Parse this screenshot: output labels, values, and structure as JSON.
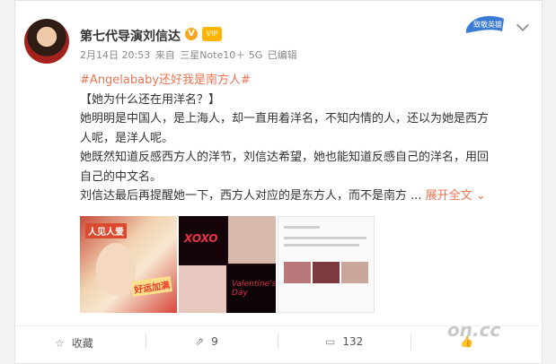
{
  "post": {
    "author": "第七代导演刘信达",
    "v_badge": "V",
    "vip_label": "VIP",
    "date": "2月14日 20:53",
    "source_prefix": "来自",
    "source_device": "三星Note10＋ 5G",
    "edited": "已编辑",
    "hashtag": "#Angelababy还好我是南方人#",
    "lines": [
      "【她为什么还在用洋名？】",
      "她明明是中国人，是上海人，却一直用着洋名，不知内情的人，还以为她是西方",
      "人呢，是洋人呢。",
      "她既然知道反感西方人的洋节，刘信达希望，她也能知道反感自己的洋名，用回",
      "自己的中文名。"
    ],
    "last_line": "刘信达最后再提醒她一下，西方人对应的是东方人，而不是南方 ...",
    "expand_label": "展开全文",
    "img1_text_a": "人见人爱",
    "img1_text_b": "好运加满",
    "img2_text_a": "XOXO",
    "img2_text_b": "Valentine's Day",
    "topright_badge": "致敬英雄"
  },
  "actions": {
    "favorite_label": "收藏",
    "repost_count": "9",
    "comment_count": "132",
    "like_count": ""
  },
  "watermark": "on.cc"
}
